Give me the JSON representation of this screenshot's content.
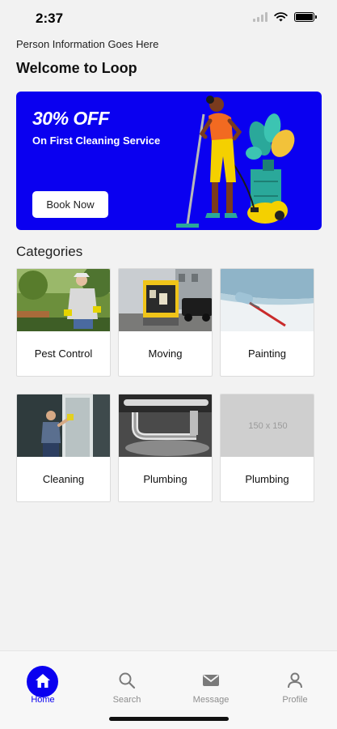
{
  "status_bar": {
    "time": "2:37"
  },
  "header": {
    "person_info": "Person Information Goes Here",
    "welcome": "Welcome to Loop"
  },
  "banner": {
    "title": "30% OFF",
    "subtitle": "On First Cleaning Service",
    "button_label": "Book Now",
    "background_color": "#0a00f0"
  },
  "categories": {
    "title": "Categories",
    "items": [
      {
        "label": "Pest Control",
        "image": "gardener-photo"
      },
      {
        "label": "Moving",
        "image": "moving-truck-photo"
      },
      {
        "label": "Painting",
        "image": "paint-roller-photo"
      },
      {
        "label": "Cleaning",
        "image": "window-cleaning-photo"
      },
      {
        "label": "Plumbing",
        "image": "sink-faucet-photo"
      },
      {
        "label": "Plumbing",
        "image": "placeholder",
        "placeholder_text": "150 x 150"
      }
    ]
  },
  "tab_bar": {
    "accent_color": "#0a00f0",
    "tabs": [
      {
        "label": "Home",
        "icon": "home-icon",
        "active": true
      },
      {
        "label": "Search",
        "icon": "search-icon",
        "active": false
      },
      {
        "label": "Message",
        "icon": "envelope-icon",
        "active": false
      },
      {
        "label": "Profile",
        "icon": "person-icon",
        "active": false
      }
    ]
  }
}
